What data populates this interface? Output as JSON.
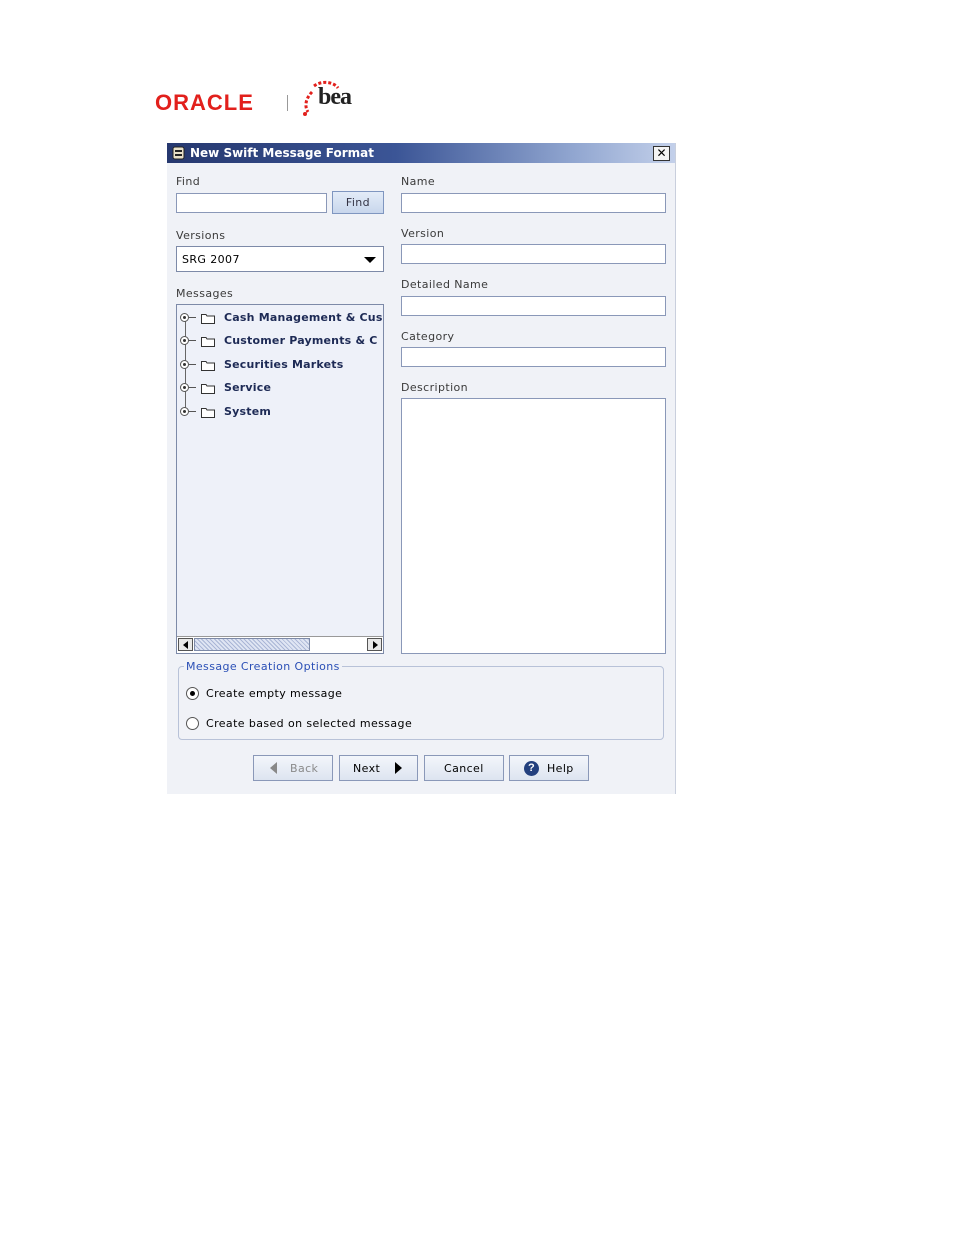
{
  "branding": {
    "oracle_logo": "ORACLE",
    "bea_logo": "bea"
  },
  "dialog": {
    "title": "New Swift Message Format",
    "close_glyph": "✕"
  },
  "find": {
    "label": "Find",
    "value": "",
    "button_label": "Find"
  },
  "versions": {
    "label": "Versions",
    "selected": "SRG 2007"
  },
  "messages": {
    "label": "Messages",
    "items": [
      {
        "label": "Cash Management & Cus"
      },
      {
        "label": "Customer Payments & C"
      },
      {
        "label": "Securities Markets"
      },
      {
        "label": "Service"
      },
      {
        "label": "System"
      }
    ]
  },
  "form": {
    "name_label": "Name",
    "name_value": "",
    "version_label": "Version",
    "version_value": "",
    "detailed_name_label": "Detailed Name",
    "detailed_name_value": "",
    "category_label": "Category",
    "category_value": "",
    "description_label": "Description",
    "description_value": ""
  },
  "creation_options": {
    "legend": "Message Creation Options",
    "options": [
      {
        "label": "Create empty message",
        "checked": true
      },
      {
        "label": "Create based on selected message",
        "checked": false
      }
    ]
  },
  "buttons": {
    "back": "Back",
    "next": "Next",
    "cancel": "Cancel",
    "help": "Help",
    "help_glyph": "?"
  },
  "colors": {
    "title_bar": "#26386f",
    "oracle_red": "#e2201c",
    "legend_blue": "#2a4fb6"
  }
}
